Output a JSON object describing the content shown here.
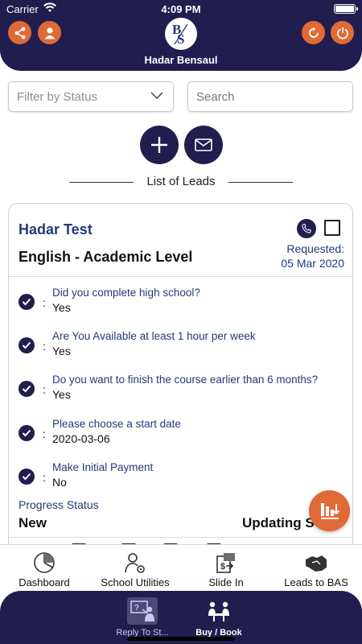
{
  "status_bar": {
    "carrier": "Carrier",
    "time": "4:09 PM"
  },
  "header": {
    "username": "Hadar Bensaul",
    "logo_icon": "bs-logo",
    "left_icons": [
      "share-icon",
      "user-icon"
    ],
    "right_icons": [
      "refresh-icon",
      "power-icon"
    ],
    "accent": "#e06a36",
    "brand": "#211d4e"
  },
  "filters": {
    "status_value": "Filter by Status",
    "search_placeholder": "Search"
  },
  "actions": {
    "add_icon": "plus-icon",
    "mail_icon": "mail-icon"
  },
  "section": {
    "title": "List of Leads"
  },
  "lead": {
    "name": "Hadar Test",
    "course": "English - Academic Level",
    "requested_label": "Requested:",
    "requested_date": "05 Mar 2020",
    "questions": [
      {
        "q": "Did you complete high school?",
        "a": "Yes"
      },
      {
        "q": "Are You Available at least 1 hour per week",
        "a": "Yes"
      },
      {
        "q": "Do you want to finish the course earlier than 6 months?",
        "a": "Yes"
      },
      {
        "q": "Please choose a start date",
        "a": "2020-03-06"
      },
      {
        "q": "Make Initial Payment",
        "a": "No"
      }
    ],
    "separator": ":",
    "progress_label": "Progress Status",
    "progress_value": "New",
    "progress_state": "Updating S"
  },
  "tabs": [
    {
      "label": "Dashboard",
      "icon": "pie-chart-icon"
    },
    {
      "label": "School Utilities",
      "icon": "user-gear-icon"
    },
    {
      "label": "Slide In",
      "icon": "slide-money-icon"
    },
    {
      "label": "Leads to BAS",
      "icon": "handshake-icon"
    }
  ],
  "bottom_nav": [
    {
      "label": "Reply To St...",
      "icon": "teacher-board-icon",
      "active": true
    },
    {
      "label": "Buy / Book",
      "icon": "meeting-table-icon",
      "active": false
    }
  ]
}
